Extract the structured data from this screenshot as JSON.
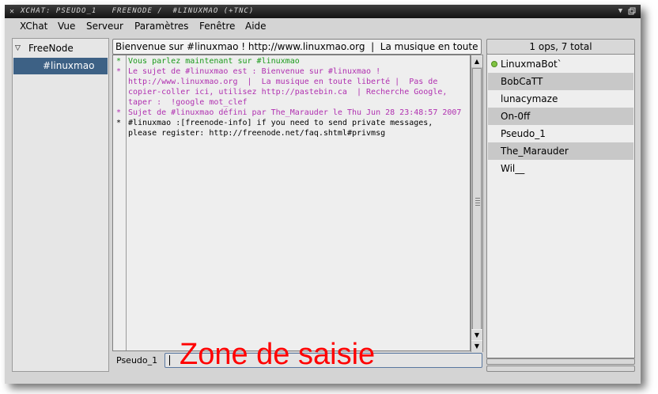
{
  "window": {
    "title": "XChat: Pseudo_1   FreeNode /  #linuxmao (+tnc)",
    "icons": {
      "app": "x-logo-icon",
      "minimize": "minimize-icon",
      "restore": "restore-icon"
    }
  },
  "menu": [
    {
      "label": "XChat"
    },
    {
      "label": "Vue"
    },
    {
      "label": "Serveur"
    },
    {
      "label": "Paramètres"
    },
    {
      "label": "Fenêtre"
    },
    {
      "label": "Aide"
    }
  ],
  "tree": {
    "network": "FreeNode",
    "channel": "#linuxmao"
  },
  "topic": "Bienvenue sur #linuxmao ! http://www.linuxmao.org  |  La musique en toute liberté",
  "chat": {
    "lines": [
      {
        "star": "*",
        "text": "Vous parlez maintenant sur #linuxmao",
        "color": "#1a9a1a"
      },
      {
        "star": "*",
        "text": "Le sujet de #linuxmao est : Bienvenue sur #linuxmao !",
        "color": "#b030b0"
      },
      {
        "star": "",
        "text": "http://www.linuxmao.org  |  La musique en toute liberté |  Pas de",
        "color": "#b030b0"
      },
      {
        "star": "",
        "text": "copier-coller ici, utilisez http://pastebin.ca  | Recherche Google,",
        "color": "#b030b0"
      },
      {
        "star": "",
        "text": "taper :  !google mot_clef",
        "color": "#b030b0"
      },
      {
        "star": "*",
        "text": "Sujet de #linuxmao défini par The_Marauder le Thu Jun 28 23:48:57 2007",
        "color": "#b030b0"
      },
      {
        "star": "*",
        "text": "#linuxmao :[freenode-info] if you need to send private messages,",
        "color": "#000000"
      },
      {
        "star": "",
        "text": "please register: http://freenode.net/faq.shtml#privmsg",
        "color": "#000000"
      }
    ]
  },
  "userlist": {
    "summary": "1 ops, 7 total",
    "users": [
      {
        "name": "LinuxmaBot`",
        "op": true
      },
      {
        "name": "BobCaTT",
        "op": false
      },
      {
        "name": "lunacymaze",
        "op": false
      },
      {
        "name": "On-0ff",
        "op": false
      },
      {
        "name": "Pseudo_1",
        "op": false
      },
      {
        "name": "The_Marauder",
        "op": false
      },
      {
        "name": "Wil__",
        "op": false
      }
    ]
  },
  "input": {
    "nick": "Pseudo_1",
    "value": "",
    "overlay_label": "Zone de saisie"
  }
}
